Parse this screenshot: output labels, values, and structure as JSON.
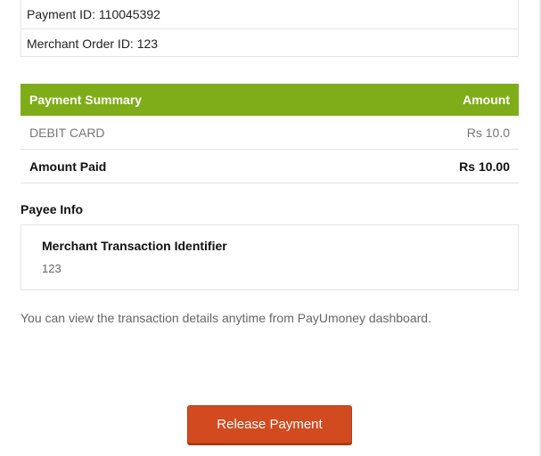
{
  "ids": {
    "payment_id": "Payment ID: 110045392",
    "merchant_order_id": "Merchant Order ID: 123"
  },
  "summary": {
    "header_left": "Payment Summary",
    "header_right": "Amount",
    "rows": [
      {
        "label": "DEBIT CARD",
        "value": "Rs 10.0"
      },
      {
        "label": "Amount Paid",
        "value": "Rs 10.00"
      }
    ],
    "header_color": "#7fad1a"
  },
  "payee": {
    "title": "Payee Info",
    "label": "Merchant Transaction Identifier",
    "value": "123"
  },
  "note": "You can view the transaction details anytime from PayUmoney dashboard.",
  "actions": {
    "release_label": "Release Payment",
    "button_color": "#d24a1f"
  }
}
